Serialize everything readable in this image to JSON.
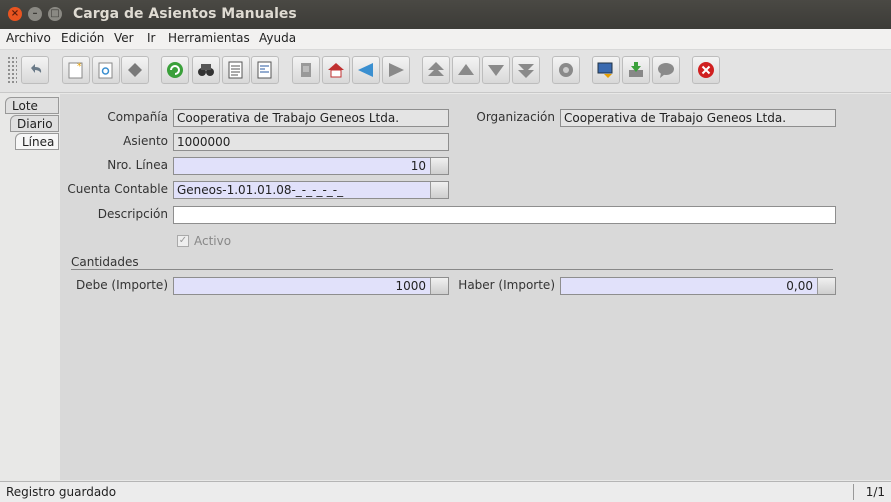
{
  "window": {
    "title": "Carga de Asientos Manuales"
  },
  "menu": [
    "Archivo",
    "Edición",
    "Ver",
    "Ir",
    "Herramientas",
    "Ayuda"
  ],
  "toolbar": {
    "icons": [
      "undo-icon",
      "new-record-icon",
      "copy-record-icon",
      "delete-icon",
      "refresh-icon",
      "find-icon",
      "report-icon",
      "form-icon",
      "attachment-icon",
      "home-icon",
      "back-icon",
      "forward-icon",
      "first-record-icon",
      "previous-record-icon",
      "next-record-icon",
      "last-record-icon",
      "workflow-icon",
      "process-icon",
      "save-icon",
      "chat-icon",
      "exit-icon"
    ]
  },
  "tabs": [
    "Lote",
    "Diario",
    "Línea"
  ],
  "form": {
    "company_label": "Compañía",
    "company_value": "Cooperativa de Trabajo Geneos Ltda.",
    "org_label": "Organización",
    "org_value": "Cooperativa de Trabajo Geneos Ltda.",
    "asiento_label": "Asiento",
    "asiento_value": "1000000",
    "line_label": "Nro. Línea",
    "line_value": "10",
    "account_label": "Cuenta Contable",
    "account_value": "Geneos-1.01.01.08-_-_-_-_-_",
    "desc_label": "Descripción",
    "desc_value": "",
    "active_label": "Activo",
    "active_checked": true,
    "section_label": "Cantidades",
    "debe_label": "Debe (Importe)",
    "debe_value": "1000",
    "haber_label": "Haber (Importe)",
    "haber_value": "0,00"
  },
  "status": {
    "message": "Registro guardado",
    "page": "1/1"
  },
  "colors": {
    "title_bar": "#3c3b37",
    "close_button": "#e95420",
    "required_field": "#e1e1fa",
    "panel": "#d9d9d9"
  }
}
